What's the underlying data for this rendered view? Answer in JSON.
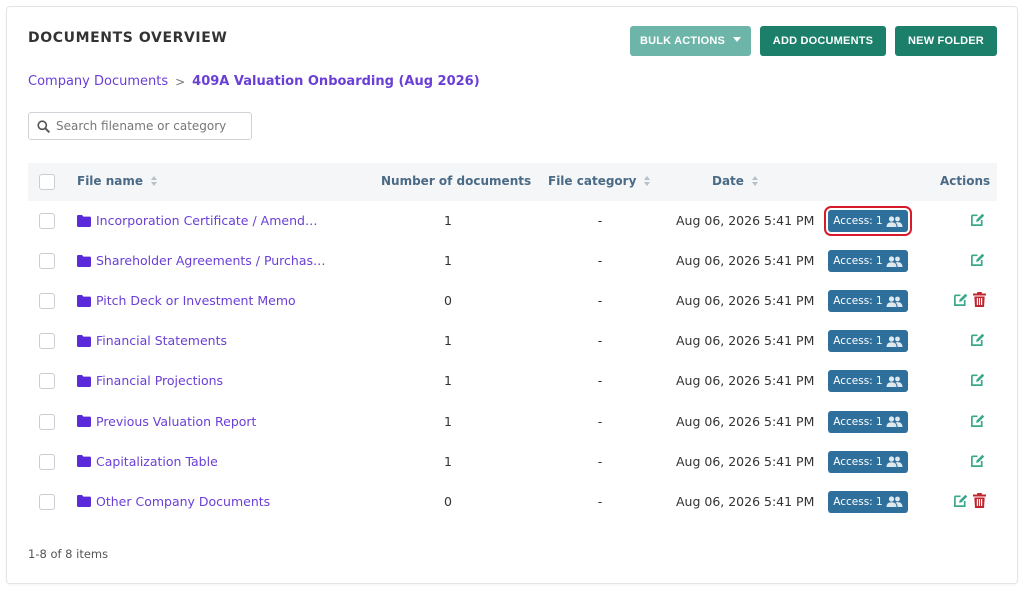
{
  "header": {
    "title": "DOCUMENTS OVERVIEW",
    "bulk_actions_label": "BULK ACTIONS",
    "add_documents_label": "ADD DOCUMENTS",
    "new_folder_label": "NEW FOLDER"
  },
  "breadcrumb": {
    "root": "Company Documents",
    "separator": ">",
    "current": "409A Valuation Onboarding (Aug 2026)"
  },
  "search": {
    "placeholder": "Search filename or category"
  },
  "table": {
    "columns": {
      "file_name": "File name",
      "number_of_documents": "Number of documents",
      "file_category": "File category",
      "date": "Date",
      "actions": "Actions"
    },
    "rows": [
      {
        "name": "Incorporation Certificate / Amendm…",
        "count": "1",
        "category": "-",
        "date": "Aug 06, 2026 5:41 PM",
        "access": "Access: 1",
        "deletable": false,
        "highlighted": true
      },
      {
        "name": "Shareholder Agreements / Purchase…",
        "count": "1",
        "category": "-",
        "date": "Aug 06, 2026 5:41 PM",
        "access": "Access: 1",
        "deletable": false,
        "highlighted": false
      },
      {
        "name": "Pitch Deck or Investment Memo",
        "count": "0",
        "category": "-",
        "date": "Aug 06, 2026 5:41 PM",
        "access": "Access: 1",
        "deletable": true,
        "highlighted": false
      },
      {
        "name": "Financial Statements",
        "count": "1",
        "category": "-",
        "date": "Aug 06, 2026 5:41 PM",
        "access": "Access: 1",
        "deletable": false,
        "highlighted": false
      },
      {
        "name": "Financial Projections",
        "count": "1",
        "category": "-",
        "date": "Aug 06, 2026 5:41 PM",
        "access": "Access: 1",
        "deletable": false,
        "highlighted": false
      },
      {
        "name": "Previous Valuation Report",
        "count": "1",
        "category": "-",
        "date": "Aug 06, 2026 5:41 PM",
        "access": "Access: 1",
        "deletable": false,
        "highlighted": false
      },
      {
        "name": "Capitalization Table",
        "count": "1",
        "category": "-",
        "date": "Aug 06, 2026 5:41 PM",
        "access": "Access: 1",
        "deletable": false,
        "highlighted": false
      },
      {
        "name": "Other Company Documents",
        "count": "0",
        "category": "-",
        "date": "Aug 06, 2026 5:41 PM",
        "access": "Access: 1",
        "deletable": true,
        "highlighted": false
      }
    ]
  },
  "footer": {
    "pagination": "1-8 of 8 items"
  },
  "colors": {
    "primary_green": "#1c7f6a",
    "light_green": "#6db5a8",
    "folder_purple": "#5b2bd9",
    "access_blue": "#2f6f9b",
    "delete_red": "#c0262d",
    "edit_green": "#3aa88a",
    "highlight_red": "#d81b2a"
  },
  "icons": {
    "search": "search-icon",
    "folder": "folder-icon",
    "users": "users-icon",
    "edit": "edit-icon",
    "delete": "trash-icon",
    "sort": "sort-icon"
  }
}
